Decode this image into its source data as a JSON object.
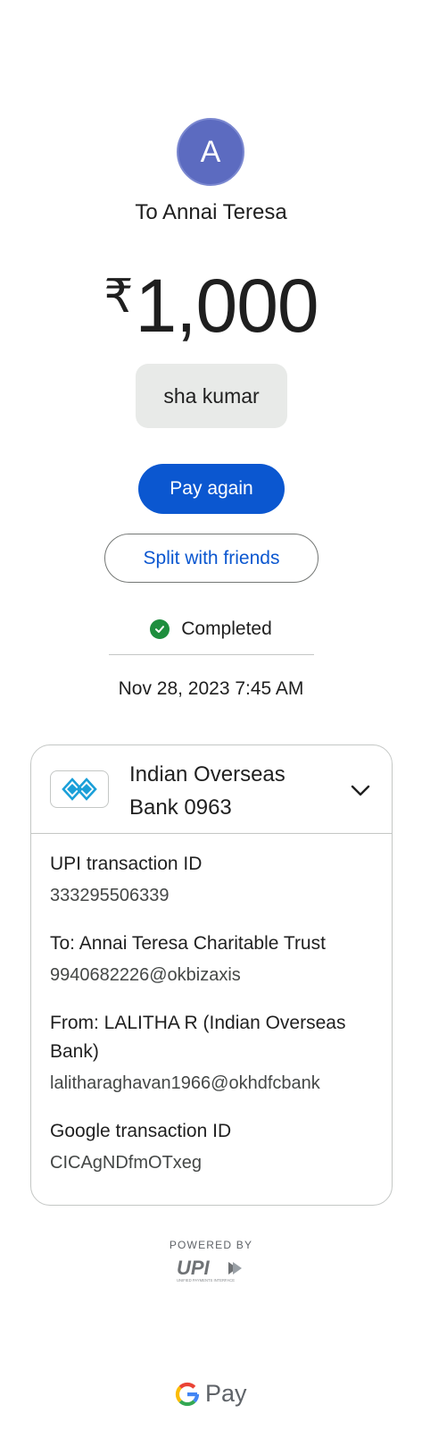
{
  "recipient": {
    "avatar_letter": "A",
    "title": "To Annai Teresa"
  },
  "payment": {
    "currency_symbol": "₹",
    "amount": "1,000",
    "note": "sha kumar"
  },
  "actions": {
    "pay_again": "Pay again",
    "split": "Split with friends"
  },
  "status": {
    "label": "Completed",
    "datetime": "Nov 28, 2023 7:45 AM"
  },
  "account": {
    "bank_line1": "Indian Overseas",
    "bank_line2": "Bank 0963",
    "details": [
      {
        "label": "UPI transaction ID",
        "value": "333295506339"
      },
      {
        "label": "To: Annai Teresa Charitable Trust",
        "value": "9940682226@okbizaxis"
      },
      {
        "label": "From: LALITHA R (Indian Overseas Bank)",
        "value": "lalitharaghavan1966@okhdfcbank"
      },
      {
        "label": "Google transaction ID",
        "value": "CICAgNDfmOTxeg"
      }
    ]
  },
  "footer": {
    "powered_by": "POWERED BY",
    "upi_logo_text": "UPI",
    "upi_tagline": "UNIFIED PAYMENTS INTERFACE",
    "brand_g": "G",
    "brand_pay": "Pay"
  },
  "colors": {
    "accent": "#0b57d0",
    "avatar": "#5c6bc0",
    "success": "#1e8e3e",
    "bank_logo": "#1a9fd8"
  },
  "icons": [
    "check-circle-icon",
    "chevron-down-icon",
    "bank-logo-icon",
    "upi-logo",
    "google-g-icon"
  ]
}
